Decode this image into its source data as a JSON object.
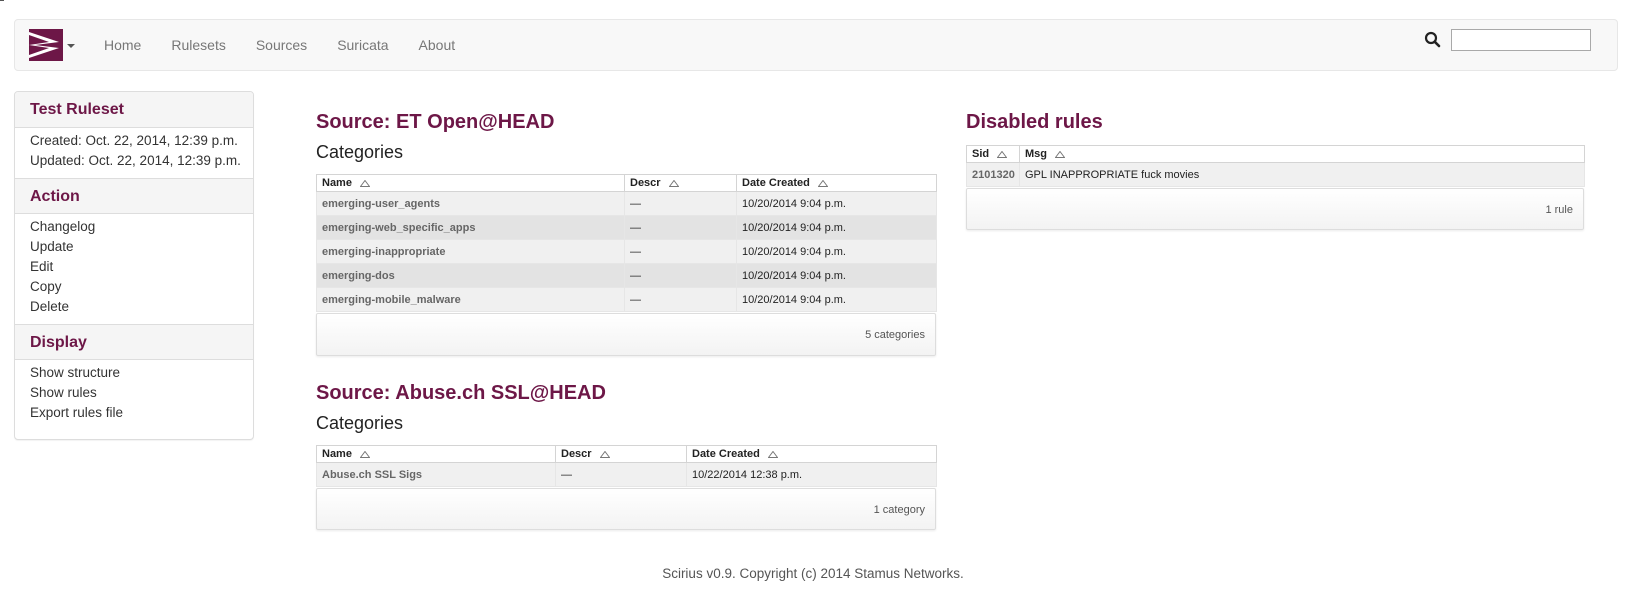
{
  "colors": {
    "brand": "#6d1747",
    "nav_text": "#777777",
    "row_odd": "#f0f0f0",
    "row_even": "#e3e3e3"
  },
  "navbar": {
    "brand_icon": "scirius-logo-icon",
    "links": [
      "Home",
      "Rulesets",
      "Sources",
      "Suricata",
      "About"
    ],
    "search_icon": "search-icon",
    "search_value": ""
  },
  "sidebar": {
    "title": "Test Ruleset",
    "created": "Created: Oct. 22, 2014, 12:39 p.m.",
    "updated": "Updated: Oct. 22, 2014, 12:39 p.m.",
    "action_heading": "Action",
    "actions": [
      "Changelog",
      "Update",
      "Edit",
      "Copy",
      "Delete"
    ],
    "display_heading": "Display",
    "displays": [
      "Show structure",
      "Show rules",
      "Export rules file"
    ]
  },
  "sources": [
    {
      "title": "Source: ET Open@HEAD",
      "subtitle": "Categories",
      "columns": [
        "Name",
        "Descr",
        "Date Created"
      ],
      "rows": [
        [
          "emerging-user_agents",
          "—",
          "10/20/2014 9:04 p.m."
        ],
        [
          "emerging-web_specific_apps",
          "—",
          "10/20/2014 9:04 p.m."
        ],
        [
          "emerging-inappropriate",
          "—",
          "10/20/2014 9:04 p.m."
        ],
        [
          "emerging-dos",
          "—",
          "10/20/2014 9:04 p.m."
        ],
        [
          "emerging-mobile_malware",
          "—",
          "10/20/2014 9:04 p.m."
        ]
      ],
      "footer": "5 categories"
    },
    {
      "title": "Source: Abuse.ch SSL@HEAD",
      "subtitle": "Categories",
      "columns": [
        "Name",
        "Descr",
        "Date Created"
      ],
      "rows": [
        [
          "Abuse.ch SSL Sigs",
          "—",
          "10/22/2014 12:38 p.m."
        ]
      ],
      "footer": "1 category"
    }
  ],
  "disabled": {
    "title": "Disabled rules",
    "columns": [
      "Sid",
      "Msg"
    ],
    "rows": [
      [
        "2101320",
        "GPL INAPPROPRIATE fuck movies"
      ]
    ],
    "footer": "1 rule"
  },
  "footer": {
    "text": "Scirius v0.9. Copyright (c) 2014 Stamus Networks."
  }
}
